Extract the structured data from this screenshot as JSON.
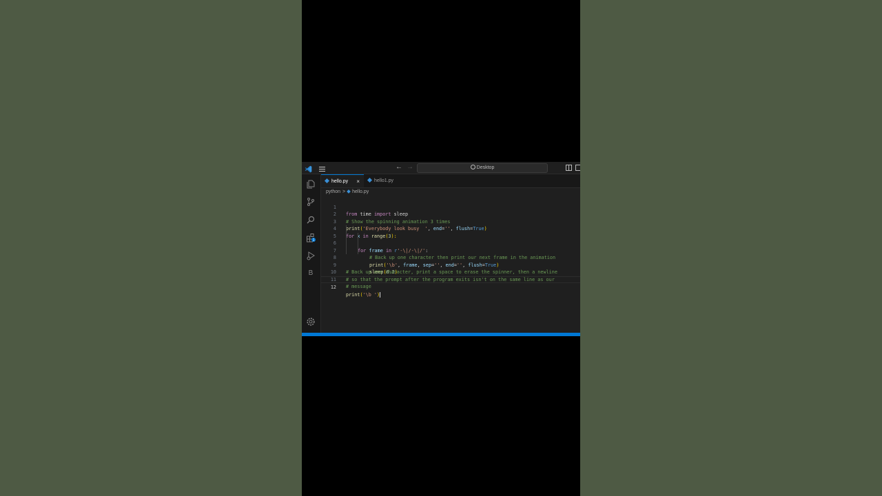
{
  "window": {
    "search_text": "Desktop",
    "back_arrow": "←",
    "forward_arrow": "→"
  },
  "tabs": [
    {
      "label": "hello.py",
      "active": true,
      "close": "×"
    },
    {
      "label": "hello1.py",
      "active": false
    }
  ],
  "breadcrumb": {
    "folder": "python",
    "sep": ">",
    "file": "hello.py"
  },
  "activity_icons": [
    "explorer-icon",
    "source-control-icon",
    "search-icon",
    "extensions-icon",
    "run-debug-icon",
    "b-icon",
    "settings-gear-icon"
  ],
  "activity_b_label": "B",
  "extensions_badge": "1",
  "editor": {
    "line_numbers": [
      "1",
      "2",
      "3",
      "4",
      "5",
      "6",
      "7",
      "8",
      "9",
      "10",
      "11",
      "12"
    ],
    "lines": {
      "l1": {
        "kw1": "from",
        "t1": " time ",
        "kw2": "import",
        "t2": " sleep"
      },
      "l2": {
        "cm": "# Show the spinning animation 3 times"
      },
      "l3": {
        "fn": "print",
        "p1": "(",
        "s1": "'Everybody look busy  '",
        "c1": ", ",
        "v1": "end",
        "e1": "=",
        "s2": "''",
        "c2": ", ",
        "v2": "flush",
        "e2": "=",
        "k1": "True",
        "p2": ")"
      },
      "l4": {
        "kw": "for",
        "t1": " ",
        "v": "x",
        "t2": " ",
        "kw2": "in",
        "t3": " ",
        "fn": "range",
        "p1": "(",
        "n": "3",
        "p2": "):"
      },
      "l5": {
        "kw": "for",
        "t1": " ",
        "v": "frame",
        "t2": " ",
        "kw2": "in",
        "t3": " ",
        "r": "r",
        "s": "'-\\|/-\\|/'",
        "p": ":"
      },
      "l6": {
        "cm": "# Back up one character then print our next frame in the animation"
      },
      "l7": {
        "fn": "print",
        "p1": "(",
        "s1": "'\\b'",
        "c1": ", ",
        "v1": "frame",
        "c2": ", ",
        "v2": "sep",
        "e1": "=",
        "s2": "''",
        "c3": ", ",
        "v3": "end",
        "e2": "=",
        "s3": "''",
        "c4": ", ",
        "v4": "flush",
        "e3": "=",
        "k": "True",
        "p2": ")"
      },
      "l8": {
        "fn": "sleep",
        "p1": "(",
        "n": "0.2",
        "p2": ")"
      },
      "l9": {
        "cm": "# Back up one character, print a space to erase the spinner, then a newline"
      },
      "l10": {
        "cm": "# so that the prompt after the program exits isn't on the same line as our"
      },
      "l11": {
        "cm": "# message"
      },
      "l12": {
        "fn": "print",
        "p1": "(",
        "s": "'\\b '",
        "p2": ")"
      }
    }
  },
  "colors": {
    "accent": "#0078d4",
    "background": "#1f1f1f",
    "outer_background": "#4e5a44"
  }
}
